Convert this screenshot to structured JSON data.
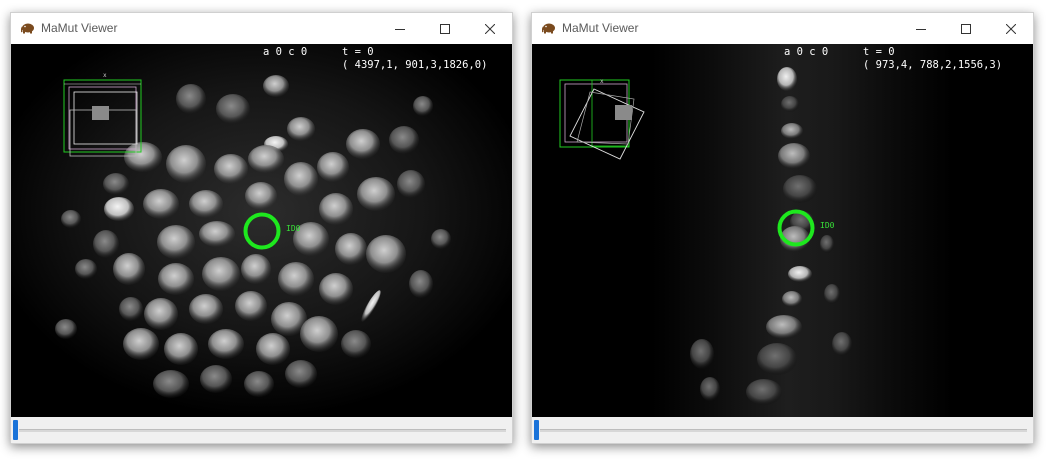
{
  "windows": [
    {
      "title": "MaMut Viewer",
      "source_info": "a 0 c 0",
      "time_label": "t = 0",
      "coordinates": "( 4397,1, 901,3,1826,0)",
      "track_label": "ID0",
      "timepoint_slider": 0.0,
      "icons": {
        "app": "mamut-elephant-icon",
        "minimize": "minimize-icon",
        "maximize": "maximize-icon",
        "close": "close-icon"
      }
    },
    {
      "title": "MaMut Viewer",
      "source_info": "a 0 c 0",
      "time_label": "t = 0",
      "coordinates": "( 973,4, 788,2,1556,3)",
      "track_label": "ID0",
      "timepoint_slider": 0.0,
      "icons": {
        "app": "mamut-elephant-icon",
        "minimize": "minimize-icon",
        "maximize": "maximize-icon",
        "close": "close-icon"
      }
    }
  ],
  "colors": {
    "selection": "#1ee81e",
    "slider_thumb": "#1a73d9",
    "title_text": "#5a5a5a"
  }
}
